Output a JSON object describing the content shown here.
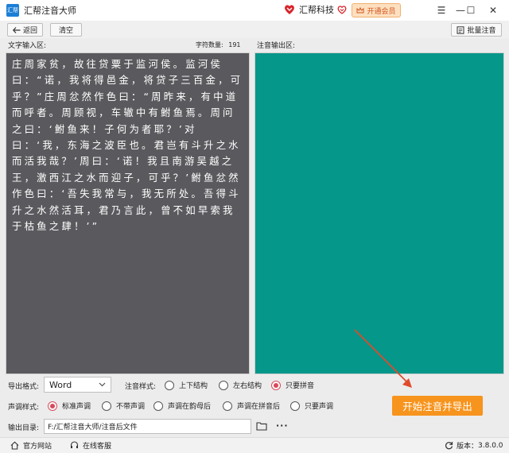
{
  "titlebar": {
    "app_title": "汇帮注音大师",
    "logo_text": "汇帮",
    "brand_name": "汇帮科技",
    "vip_label": "开通会员",
    "controls": {
      "menu": "☰",
      "minimize": "—",
      "maximize": "☐",
      "close": "✕"
    }
  },
  "toolbar": {
    "back_label": "返回",
    "clear_label": "清空",
    "batch_label": "批量注音"
  },
  "input_panel": {
    "label": "文字输入区:",
    "count_label": "字符数量:",
    "count_value": "191",
    "text": "庄周家贫，故往贷粟于监河侯。监河侯曰：“诺，我将得邑金，将贷子三百金，可乎？”庄周忿然作色曰：“周昨来，有中道而呼者。周顾视，车辙中有鲋鱼焉。周问之曰：‘鲋鱼来！子何为者耶？’对曰：‘我，东海之波臣也。君岂有斗升之水而活我哉？’周曰：‘诺！我且南游吴越之王，激西江之水而迎子，可乎？’鲋鱼忿然作色曰：‘吾失我常与，我无所处。吾得斗升之水然活耳，君乃言此，曾不如早索我于枯鱼之肆！’”"
  },
  "output_panel": {
    "label": "注音输出区:"
  },
  "options": {
    "export_format_label": "导出格式:",
    "export_format_value": "Word",
    "style_label": "注音样式:",
    "style_options": [
      {
        "label": "上下结构",
        "selected": false
      },
      {
        "label": "左右结构",
        "selected": false
      },
      {
        "label": "只要拼音",
        "selected": true
      }
    ],
    "tone_label": "声调样式:",
    "tone_options": [
      {
        "label": "标准声调",
        "selected": true
      },
      {
        "label": "不带声调",
        "selected": false
      },
      {
        "label": "声调在韵母后",
        "selected": false
      },
      {
        "label": "声调在拼音后",
        "selected": false
      },
      {
        "label": "只要声调",
        "selected": false
      }
    ],
    "output_dir_label": "输出目录:",
    "output_dir_value": "F:/汇帮注音大师/注音后文件",
    "more_label": "···"
  },
  "actions": {
    "start_label": "开始注音并导出"
  },
  "statusbar": {
    "website_label": "官方网站",
    "support_label": "在线客服",
    "version_label": "版本：",
    "version_value": "3.8.0.0"
  },
  "colors": {
    "accent_orange": "#f7941d",
    "output_bg": "#05978a",
    "input_bg": "#5a5a5e",
    "radio_selected": "#d84a5a",
    "annotation_arrow": "#e04a2a"
  }
}
